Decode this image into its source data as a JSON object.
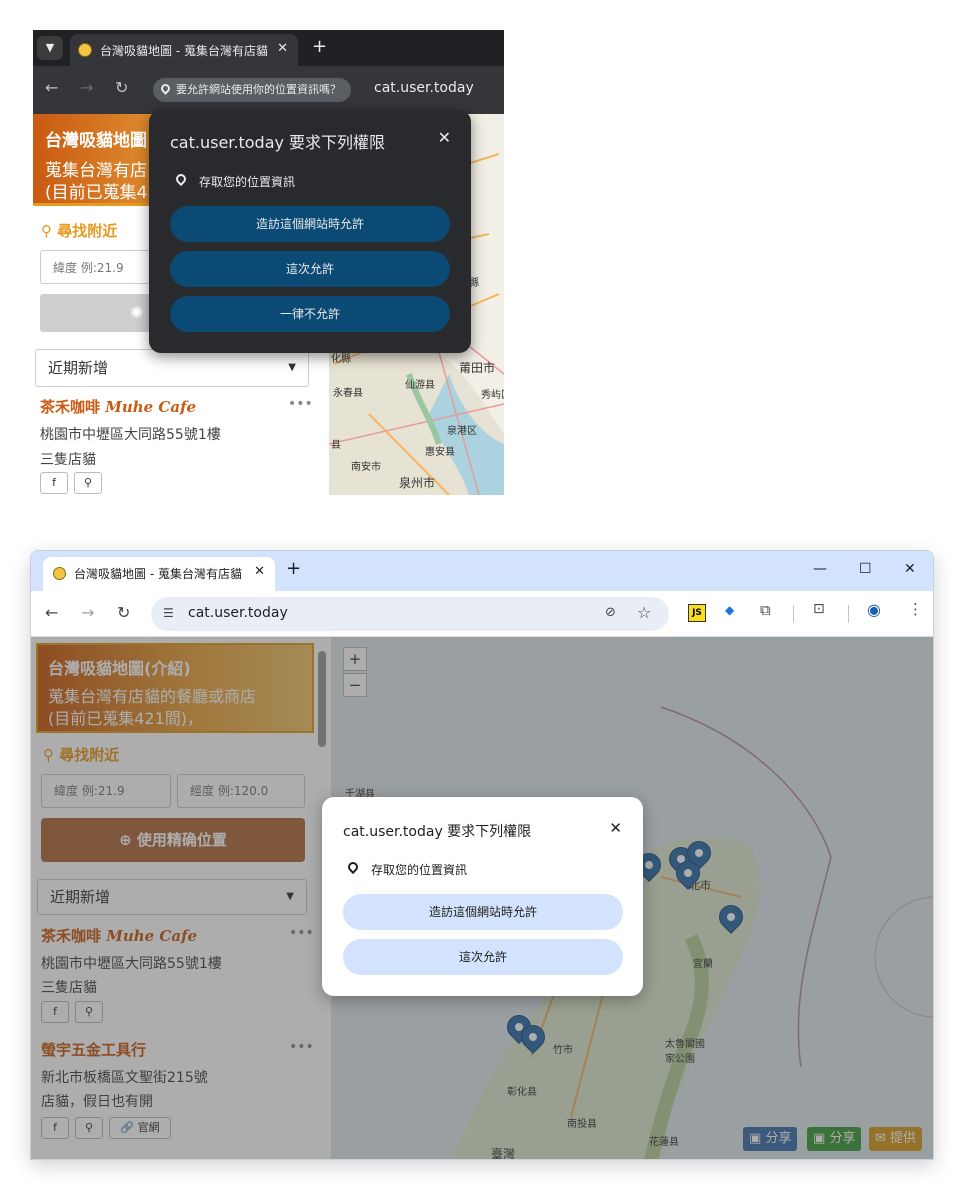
{
  "top": {
    "tab_menu_icon": "chevron-down-icon",
    "tab_title": "台灣吸貓地圖 - 蒐集台灣有店貓",
    "tab_close": "✕",
    "new_tab": "+",
    "location_chip": "要允許網站使用你的位置資訊嗎？",
    "url": "cat.user.today",
    "banner": {
      "title": "台灣吸貓地圖",
      "line2": "蒐集台灣有店",
      "line3": "(目前已蒐集4"
    },
    "nearby_label": "尋找附近",
    "lat_placeholder": "緯度 例:21.9",
    "sort_select": "近期新增",
    "shop": {
      "name": "茶禾咖啡",
      "name_en": "Muhe Cafe",
      "address": "桃園市中壢區大同路55號1樓",
      "cats": "三隻店貓"
    },
    "map_labels": [
      "縣",
      "莆田市",
      "化縣",
      "仙游县",
      "永春县",
      "秀屿区",
      "泉港区",
      "惠安县",
      "南安市",
      "泉州市",
      "县"
    ],
    "dialog": {
      "title": "cat.user.today 要求下列權限",
      "permission": "存取您的位置資訊",
      "buttons": [
        "造訪這個網站時允許",
        "這次允許",
        "一律不允許"
      ]
    }
  },
  "bottom": {
    "tab_title": "台灣吸貓地圖 - 蒐集台灣有店貓",
    "tab_close": "✕",
    "new_tab": "+",
    "url": "cat.user.today",
    "window_controls": {
      "minimize": "—",
      "maximize": "☐",
      "close": "✕"
    },
    "banner": {
      "title": "台灣吸貓地圖(介紹)",
      "line2": "蒐集台灣有店貓的餐廳或商店",
      "line3": "(目前已蒐集421間)，"
    },
    "nearby_label": "尋找附近",
    "lat_placeholder": "緯度 例:21.9",
    "lng_placeholder": "經度 例:120.0",
    "locate_button": "使用精确位置",
    "sort_select": "近期新增",
    "shops": [
      {
        "name": "茶禾咖啡",
        "name_en": "Muhe Cafe",
        "address": "桃園市中壢區大同路55號1樓",
        "cats": "三隻店貓"
      },
      {
        "name": "螢宇五金工具行",
        "name_en": "",
        "address": "新北市板橋區文聖街215號",
        "cats": "店貓，假日也有開"
      }
    ],
    "website_label": "官網",
    "zoom_in": "+",
    "zoom_out": "−",
    "map_labels": [
      "千湖县",
      "北市",
      "宜蘭",
      "竹市",
      "太魯閣國家公園",
      "彰化县",
      "南投县",
      "花蓮县",
      "臺灣"
    ],
    "share_buttons": [
      {
        "label": "分享",
        "color": "#3b6ea8"
      },
      {
        "label": "分享",
        "color": "#3c9a3c"
      },
      {
        "label": "提供",
        "color": "#d49a1c"
      }
    ],
    "dialog": {
      "title": "cat.user.today 要求下列權限",
      "permission": "存取您的位置資訊",
      "buttons": [
        "造訪這個網站時允許",
        "這次允許"
      ]
    }
  }
}
